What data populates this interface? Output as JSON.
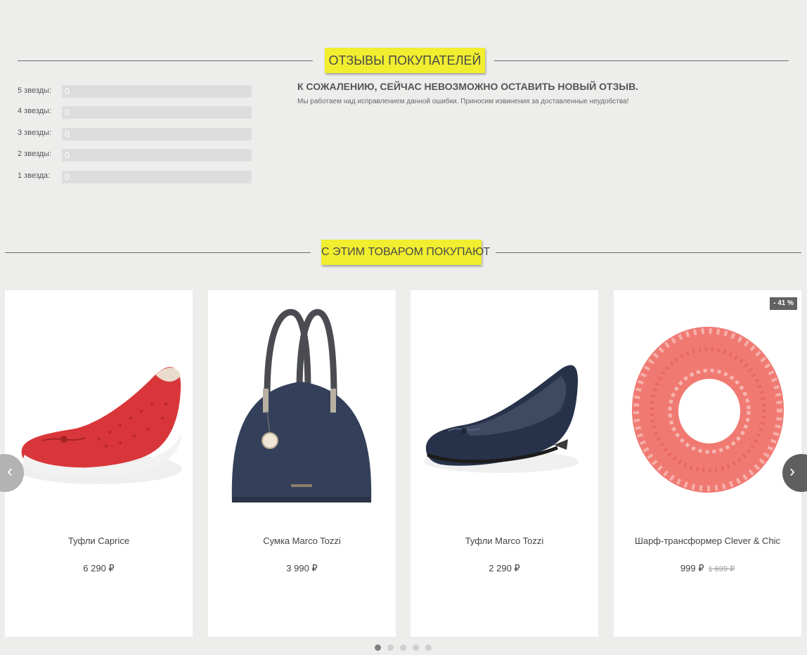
{
  "reviews": {
    "title": "ОТЗЫВЫ ПОКУПАТЕЛЕЙ",
    "ratings": [
      {
        "label": "5 звезды:",
        "count": "0",
        "fraction": 0
      },
      {
        "label": "4 звезды:",
        "count": "0",
        "fraction": 0
      },
      {
        "label": "3 звезды:",
        "count": "0",
        "fraction": 0
      },
      {
        "label": "2 звезды:",
        "count": "0",
        "fraction": 0
      },
      {
        "label": "1 звезда:",
        "count": "0",
        "fraction": 0
      }
    ],
    "notice_title": "К сожалению, сейчас невозможно оставить новый отзыв.",
    "notice_text": "Мы работаем над исправлением данной ошибки. Приносим извинения за доставленные неудобства!"
  },
  "related": {
    "title": "С ЭТИМ ТОВАРОМ ПОКУПАЮТ",
    "products": [
      {
        "name": "Туфли Caprice",
        "price": "6 290 ₽",
        "image_icon": "red-ballet-flat-image"
      },
      {
        "name": "Сумка Marco Tozzi",
        "price": "3 990 ₽",
        "image_icon": "navy-handbag-image"
      },
      {
        "name": "Туфли Marco Tozzi",
        "price": "2 290 ₽",
        "image_icon": "navy-ballet-flat-image"
      },
      {
        "name": "Шарф-трансформер Clever & Chic",
        "price": "999 ₽",
        "old_price": "1 699 ₽",
        "badge": "- 41 %",
        "image_icon": "coral-knit-scarf-image"
      }
    ],
    "prev_label": "‹",
    "next_label": "›",
    "pagination": {
      "pages": 5,
      "active": 1
    }
  },
  "colors": {
    "background": "#edeeec",
    "accent_yellow": "#f0ee2f",
    "badge": "#616161"
  }
}
